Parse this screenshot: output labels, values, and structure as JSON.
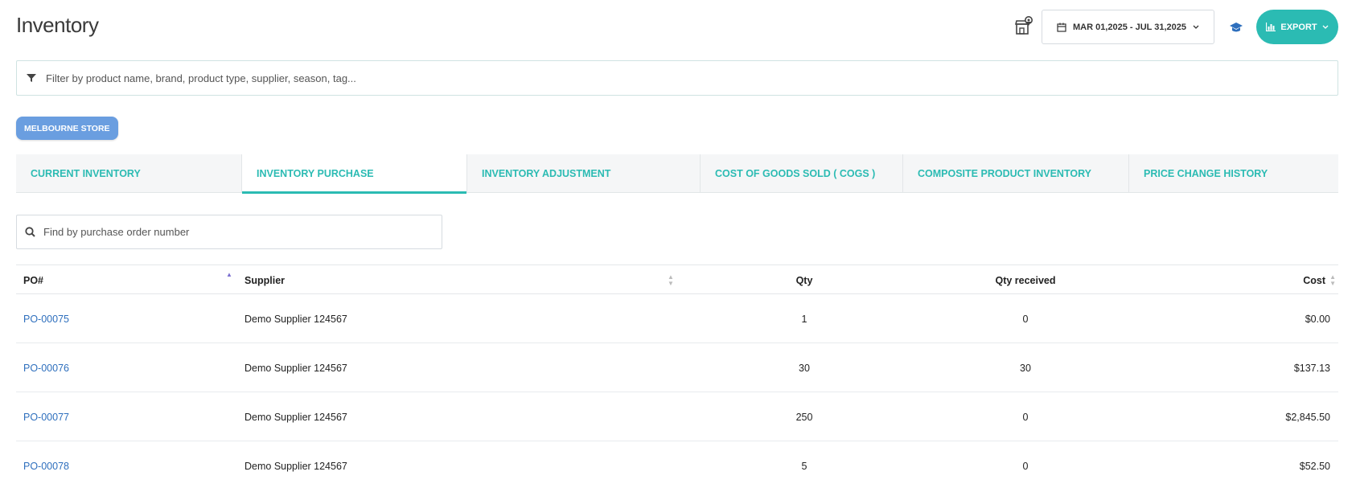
{
  "header": {
    "title": "Inventory",
    "date_range": "MAR 01,2025 - JUL 31,2025",
    "export_label": "EXPORT",
    "accent_color": "#2bbbb3"
  },
  "filter": {
    "placeholder": "Filter by product name, brand, product type, supplier, season, tag..."
  },
  "store_chip": "MELBOURNE STORE",
  "tabs": [
    {
      "label": "CURRENT INVENTORY",
      "active": false
    },
    {
      "label": "INVENTORY PURCHASE",
      "active": true
    },
    {
      "label": "INVENTORY ADJUSTMENT",
      "active": false
    },
    {
      "label": "COST OF GOODS SOLD ( COGS )",
      "active": false
    },
    {
      "label": "COMPOSITE PRODUCT INVENTORY",
      "active": false
    },
    {
      "label": "PRICE CHANGE HISTORY",
      "active": false
    }
  ],
  "po_search": {
    "placeholder": "Find by purchase order number"
  },
  "table": {
    "columns": [
      "PO#",
      "Supplier",
      "Qty",
      "Qty received",
      "Cost"
    ],
    "rows": [
      {
        "po": "PO-00075",
        "supplier": "Demo Supplier 124567",
        "qty": "1",
        "qty_received": "0",
        "cost": "$0.00"
      },
      {
        "po": "PO-00076",
        "supplier": "Demo Supplier 124567",
        "qty": "30",
        "qty_received": "30",
        "cost": "$137.13"
      },
      {
        "po": "PO-00077",
        "supplier": "Demo Supplier 124567",
        "qty": "250",
        "qty_received": "0",
        "cost": "$2,845.50"
      },
      {
        "po": "PO-00078",
        "supplier": "Demo Supplier 124567",
        "qty": "5",
        "qty_received": "0",
        "cost": "$52.50"
      }
    ]
  },
  "icons": {
    "store_locator": "store-location-icon",
    "calendar": "calendar-icon",
    "learn": "graduation-cap-icon",
    "export": "bar-chart-icon",
    "filter": "funnel-icon",
    "search": "search-icon"
  }
}
